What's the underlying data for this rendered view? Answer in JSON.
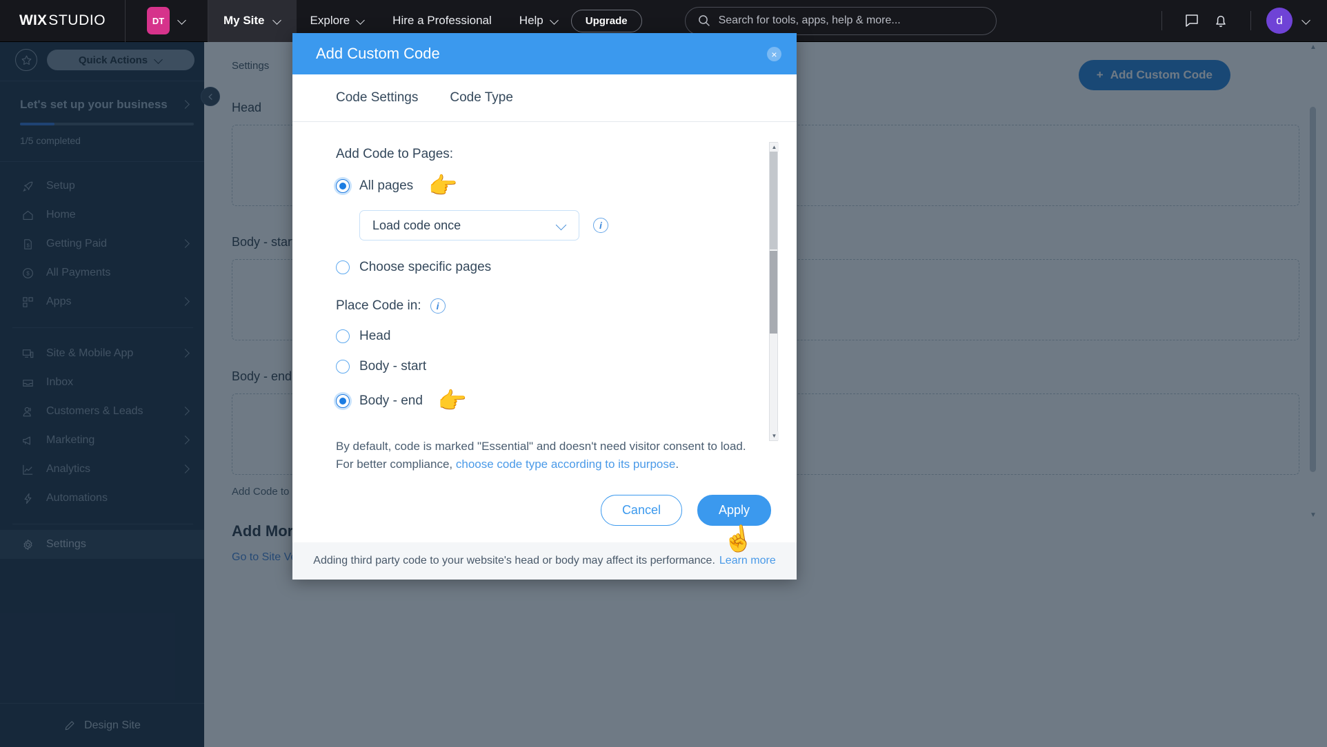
{
  "topbar": {
    "logo_bold": "WIX",
    "logo_thin": "STUDIO",
    "site_initials": "DT",
    "my_site": "My Site",
    "explore": "Explore",
    "hire": "Hire a Professional",
    "help": "Help",
    "upgrade": "Upgrade",
    "search_placeholder": "Search for tools, apps, help & more...",
    "avatar_initial": "d"
  },
  "sidebar": {
    "quick_actions": "Quick Actions",
    "setup_title": "Let's set up your business",
    "progress_label": "1/5 completed",
    "progress_percent": 20,
    "items": [
      {
        "label": "Setup",
        "icon": "rocket-icon",
        "chevron": false,
        "active": false
      },
      {
        "label": "Home",
        "icon": "home-icon",
        "chevron": false,
        "active": false
      },
      {
        "label": "Getting Paid",
        "icon": "invoice-dollar-icon",
        "chevron": true,
        "active": false
      },
      {
        "label": "All Payments",
        "icon": "dollar-circle-icon",
        "chevron": false,
        "active": false
      },
      {
        "label": "Apps",
        "icon": "apps-grid-icon",
        "chevron": true,
        "active": false
      }
    ],
    "items2": [
      {
        "label": "Site & Mobile App",
        "icon": "monitor-mobile-icon",
        "chevron": true,
        "active": false
      },
      {
        "label": "Inbox",
        "icon": "inbox-icon",
        "chevron": false,
        "active": false
      },
      {
        "label": "Customers & Leads",
        "icon": "people-icon",
        "chevron": true,
        "active": false
      },
      {
        "label": "Marketing",
        "icon": "megaphone-icon",
        "chevron": true,
        "active": false
      },
      {
        "label": "Analytics",
        "icon": "chart-line-icon",
        "chevron": true,
        "active": false
      },
      {
        "label": "Automations",
        "icon": "bolt-icon",
        "chevron": false,
        "active": false
      }
    ],
    "items3": [
      {
        "label": "Settings",
        "icon": "gear-icon",
        "chevron": false,
        "active": true
      }
    ],
    "design_site": "Design Site"
  },
  "main": {
    "breadcrumb": "Settings",
    "add_custom_code_button": "Add Custom Code",
    "section_head": "Head",
    "section_body_start": "Body - start",
    "section_body_end": "Body - end",
    "add_link": "Add Code to Head",
    "big_heading": "Add More Code",
    "bullet_text": "Go to Site Verification to verify ownership of your website on Google, Pinterest and more."
  },
  "modal": {
    "title": "Add Custom Code",
    "close_label": "×",
    "tabs": [
      {
        "label": "Code Settings",
        "active": true
      },
      {
        "label": "Code Type",
        "active": false
      }
    ],
    "add_code_to_pages_label": "Add Code to Pages:",
    "pages_options": [
      {
        "label": "All pages",
        "checked": true,
        "has_hand": true
      },
      {
        "label": "Choose specific pages",
        "checked": false,
        "has_hand": false
      }
    ],
    "load_select_value": "Load code once",
    "place_code_in_label": "Place Code in:",
    "place_options": [
      {
        "label": "Head",
        "checked": false,
        "has_hand": false
      },
      {
        "label": "Body - start",
        "checked": false,
        "has_hand": false
      },
      {
        "label": "Body - end",
        "checked": true,
        "has_hand": true
      }
    ],
    "disclaimer_line1": "By default, code is marked \"Essential\" and doesn't need visitor consent to load.",
    "disclaimer_line2_prefix": "For better compliance, ",
    "disclaimer_link": "choose code type according to its purpose",
    "disclaimer_line2_suffix": ".",
    "cancel_label": "Cancel",
    "apply_label": "Apply",
    "note_text": "Adding third party code to your website's head or body may affect its performance.",
    "note_link": "Learn more"
  },
  "colors": {
    "accent_blue": "#3b99ee",
    "sidebar_bg": "#16293c",
    "topbar_bg": "#16171c",
    "badge_pink": "#d6338b",
    "avatar_purple": "#6f43d6"
  }
}
